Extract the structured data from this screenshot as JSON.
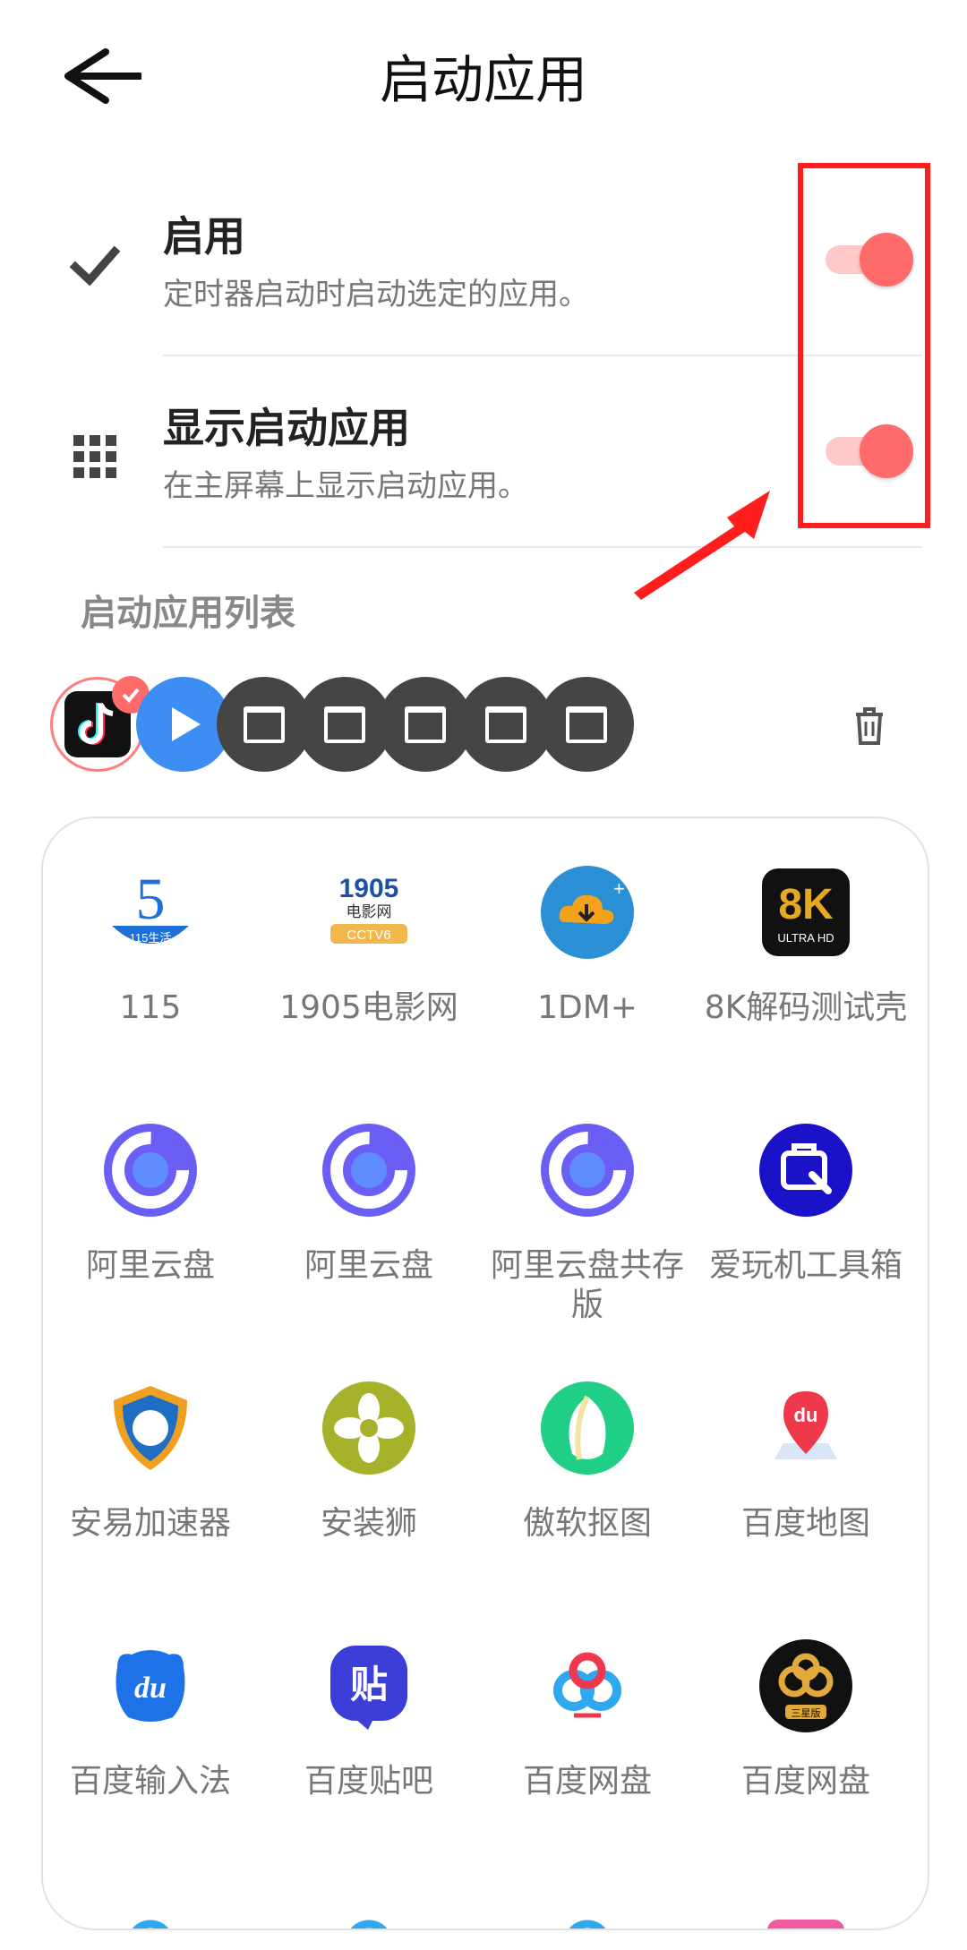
{
  "header": {
    "title": "启动应用"
  },
  "settings": [
    {
      "title": "启用",
      "subtitle": "定时器启动时启动选定的应用。",
      "enabled": true
    },
    {
      "title": "显示启动应用",
      "subtitle": "在主屏幕上显示启动应用。",
      "enabled": true
    }
  ],
  "section_title": "启动应用列表",
  "colors": {
    "accent": "#ff6b6b",
    "highlight": "#ff1d1d",
    "chip": "#454545",
    "play": "#3d8df2"
  },
  "apps": [
    {
      "label": "115",
      "icon": "115-life-icon"
    },
    {
      "label": "1905电影网",
      "icon": "1905-movie-icon",
      "icon_text": "1905",
      "icon_sub": "电影网",
      "icon_sub2": "CCTV6"
    },
    {
      "label": "1DM+",
      "icon": "1dm-download-icon"
    },
    {
      "label": "8K解码测试壳",
      "icon": "8k-ultrahd-icon",
      "icon_text": "8K",
      "icon_sub": "ULTRA HD"
    },
    {
      "label": "阿里云盘",
      "icon": "aliyun-drive-icon"
    },
    {
      "label": "阿里云盘",
      "icon": "aliyun-drive-icon"
    },
    {
      "label": "阿里云盘共存版",
      "icon": "aliyun-drive-icon"
    },
    {
      "label": "爱玩机工具箱",
      "icon": "toolbox-icon"
    },
    {
      "label": "安易加速器",
      "icon": "shield-accelerator-icon"
    },
    {
      "label": "安装狮",
      "icon": "flower-installer-icon"
    },
    {
      "label": "傲软抠图",
      "icon": "cutout-leaf-icon"
    },
    {
      "label": "百度地图",
      "icon": "baidu-map-pin-icon",
      "icon_text": "du"
    },
    {
      "label": "百度输入法",
      "icon": "baidu-input-icon",
      "icon_text": "du"
    },
    {
      "label": "百度贴吧",
      "icon": "baidu-tieba-icon",
      "icon_text": "贴"
    },
    {
      "label": "百度网盘",
      "icon": "baidu-netdisk-icon"
    },
    {
      "label": "百度网盘",
      "icon": "baidu-netdisk-samsung-icon",
      "icon_sub": "三星版"
    }
  ]
}
